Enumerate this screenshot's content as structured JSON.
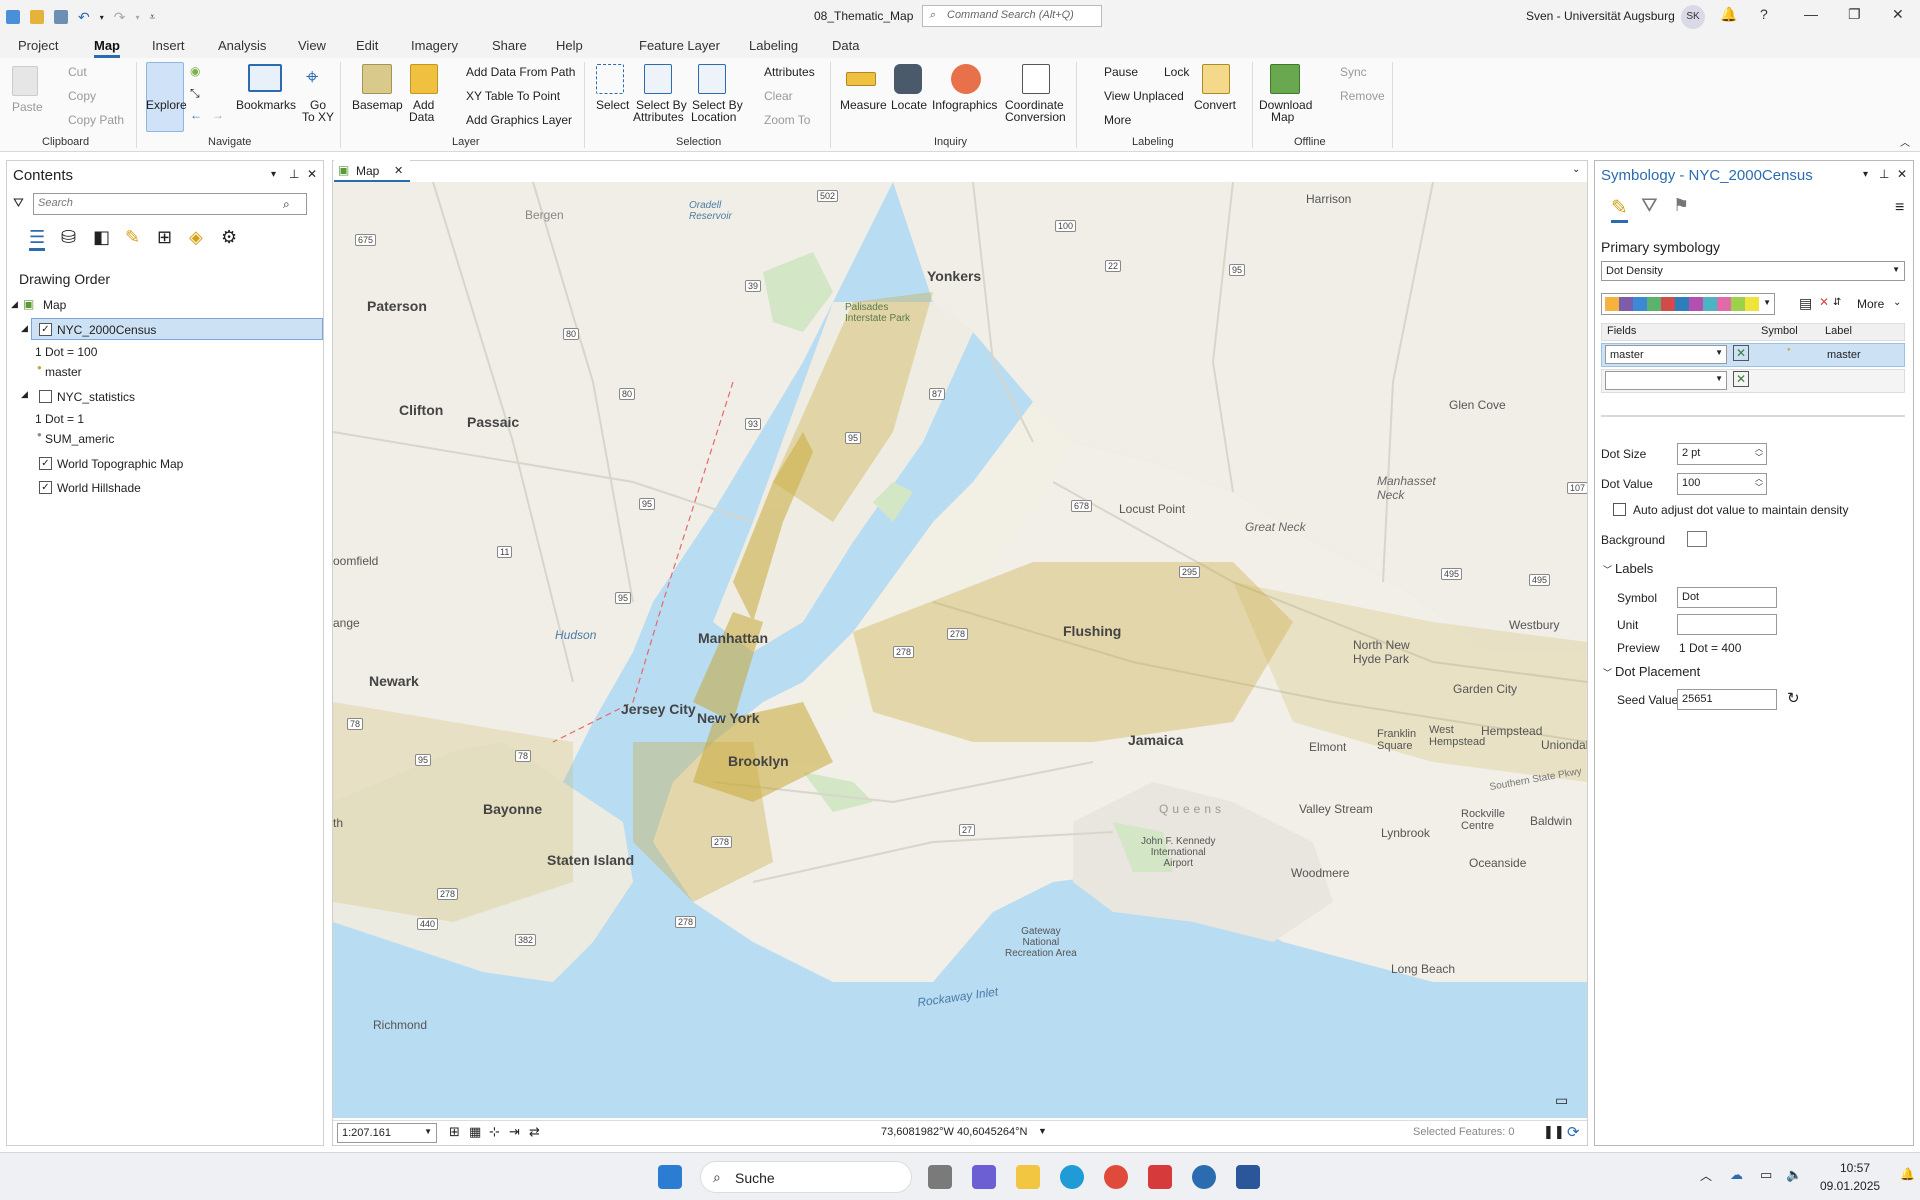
{
  "window": {
    "title": "08_Thematic_Map",
    "command_search_placeholder": "Command Search (Alt+Q)",
    "user": "Sven - Universität Augsburg",
    "user_initials": "SK",
    "help": "?"
  },
  "ribbon_tabs": [
    "Project",
    "Map",
    "Insert",
    "Analysis",
    "View",
    "Edit",
    "Imagery",
    "Share",
    "Help"
  ],
  "context_tabs": [
    "Feature Layer",
    "Labeling",
    "Data"
  ],
  "ribbon": {
    "clipboard": {
      "paste": "Paste",
      "cut": "Cut",
      "copy": "Copy",
      "copy_path": "Copy Path",
      "group": "Clipboard"
    },
    "navigate": {
      "explore": "Explore",
      "bookmarks": "Bookmarks",
      "go_to_xy_1": "Go",
      "go_to_xy_2": "To XY",
      "group": "Navigate"
    },
    "layer": {
      "basemap": "Basemap",
      "add_data_1": "Add",
      "add_data_2": "Data",
      "add_data_from_path": "Add Data From Path",
      "xy_table": "XY Table To Point",
      "add_graphics": "Add Graphics Layer",
      "group": "Layer"
    },
    "selection": {
      "select": "Select",
      "by_attr_1": "Select By",
      "by_attr_2": "Attributes",
      "by_loc_1": "Select By",
      "by_loc_2": "Location",
      "attributes": "Attributes",
      "clear": "Clear",
      "zoom_to": "Zoom To",
      "group": "Selection"
    },
    "inquiry": {
      "measure": "Measure",
      "locate": "Locate",
      "infographics": "Infographics",
      "coord_1": "Coordinate",
      "coord_2": "Conversion",
      "group": "Inquiry"
    },
    "labeling": {
      "pause": "Pause",
      "lock": "Lock",
      "view_unplaced": "View Unplaced",
      "more": "More",
      "convert": "Convert",
      "group": "Labeling"
    },
    "offline": {
      "download_1": "Download",
      "download_2": "Map",
      "sync": "Sync",
      "remove": "Remove",
      "group": "Offline"
    }
  },
  "contents": {
    "title": "Contents",
    "search_placeholder": "Search",
    "drawing_order": "Drawing Order",
    "map": "Map",
    "layers": [
      {
        "name": "NYC_2000Census",
        "checked": true,
        "legend_title": "1 Dot = 100",
        "legend_item": "master"
      },
      {
        "name": "NYC_statistics",
        "checked": false,
        "legend_title": "1 Dot = 1",
        "legend_item": "SUM_americ"
      },
      {
        "name": "World Topographic Map",
        "checked": true
      },
      {
        "name": "World Hillshade",
        "checked": true
      }
    ]
  },
  "map_view": {
    "tab": "Map",
    "scale": "1:207.161",
    "coordinates": "73,6081982°W 40,6045264°N",
    "selected_features": "Selected Features: 0",
    "labels": {
      "manhattan": "Manhattan",
      "new_york": "New York",
      "brooklyn": "Brooklyn",
      "jersey_city": "Jersey City",
      "newark": "Newark",
      "staten_island": "Staten Island",
      "bayonne": "Bayonne",
      "yonkers": "Yonkers",
      "paterson": "Paterson",
      "clifton": "Clifton",
      "passaic": "Passaic",
      "bergen": "Bergen",
      "flushing": "Flushing",
      "jamaica": "Jamaica",
      "queens": "Queens",
      "glen_cove": "Glen Cove",
      "manhasset_neck": "Manhasset\nNeck",
      "great_neck": "Great Neck",
      "locust_point": "Locust Point",
      "harrison": "Harrison",
      "westbury": "Westbury",
      "north_new_hyde_park": "North New\nHyde Park",
      "garden_city": "Garden City",
      "elmont": "Elmont",
      "franklin_square": "Franklin\nSquare",
      "west_hempstead": "West\nHempstead",
      "hempstead": "Hempstead",
      "uniondale": "Uniondal",
      "valley_stream": "Valley Stream",
      "lynbrook": "Lynbrook",
      "rockville_centre": "Rockville\nCentre",
      "baldwin": "Baldwin",
      "oceanside": "Oceanside",
      "woodmere": "Woodmere",
      "long_beach": "Long Beach",
      "jfk": "John F. Kennedy\nInternational\nAirport",
      "gateway": "Gateway\nNational\nRecreation Area",
      "rockaway_inlet": "Rockaway Inlet",
      "richmond": "Richmond",
      "hudson": "Hudson",
      "palisades": "Palisades\nInterstate Park",
      "oradell": "Oradell\nReservoir",
      "bloomfield": "oomfield",
      "orange": "ange",
      "north": "th",
      "southern_state": "Southern State Pkwy"
    },
    "shields": [
      "502",
      "100",
      "22",
      "95",
      "675",
      "39",
      "80",
      "80",
      "93",
      "95",
      "87",
      "95",
      "678",
      "11",
      "95",
      "295",
      "495",
      "495",
      "107",
      "278",
      "278",
      "78",
      "95",
      "78",
      "278",
      "27",
      "278",
      "440",
      "278",
      "382"
    ]
  },
  "symbology": {
    "title": "Symbology - NYC_2000Census",
    "primary": "Primary symbology",
    "method": "Dot Density",
    "more": "More",
    "col_fields": "Fields",
    "col_symbol": "Symbol",
    "col_label": "Label",
    "field_1": "master",
    "label_1": "master",
    "field_2": "",
    "dot_size_label": "Dot Size",
    "dot_size": "2 pt",
    "dot_value_label": "Dot Value",
    "dot_value": "100",
    "auto_adjust": "Auto adjust dot value to maintain density",
    "background": "Background",
    "labels_section": "Labels",
    "symbol_label": "Symbol",
    "symbol_value": "Dot",
    "unit_label": "Unit",
    "unit_value": "",
    "preview_label": "Preview",
    "preview_value": "1 Dot = 400",
    "placement_section": "Dot Placement",
    "seed_label": "Seed Value",
    "seed_value": "25651",
    "ramp_colors": [
      "#f4b43c",
      "#7b5ea7",
      "#3c8ad6",
      "#5ab36b",
      "#d24b4b",
      "#2c7fb8",
      "#b24fb0",
      "#4cb5c4",
      "#e36aa8",
      "#9dd04b",
      "#f0e43c"
    ]
  },
  "taskbar": {
    "search": "Suche",
    "time": "10:57",
    "date": "09.01.2025"
  },
  "colors": {
    "accent": "#2b6cb0",
    "water": "#b8dcf2",
    "land": "#f1efe7",
    "dots": "#c8a93a"
  }
}
